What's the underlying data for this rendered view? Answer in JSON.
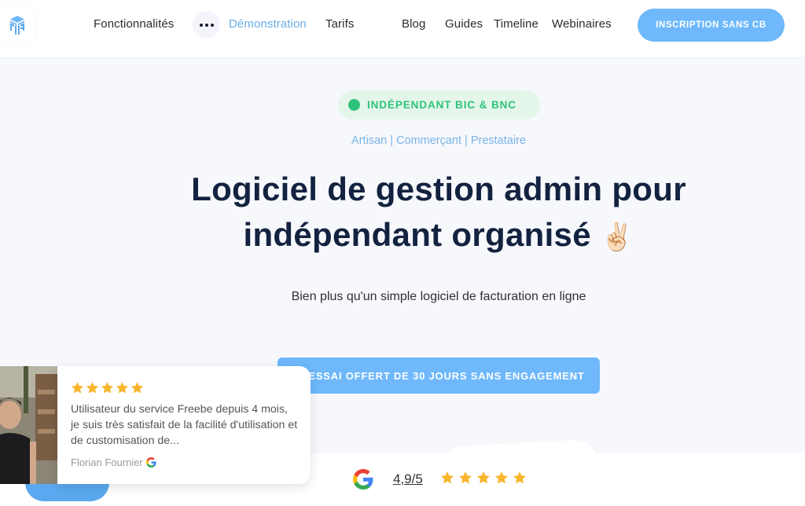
{
  "header": {
    "logo_icon": "freebe-logo-icon",
    "nav": [
      {
        "label": "Fonctionnalités",
        "active": false
      },
      {
        "label": "Démonstration",
        "active": true
      },
      {
        "label": "Tarifs",
        "active": false
      },
      {
        "label": "Blog",
        "active": false
      },
      {
        "label": "Guides",
        "active": false
      },
      {
        "label": "Timeline",
        "active": false
      },
      {
        "label": "Webinaires",
        "active": false
      }
    ],
    "more_icon": "more-horizontal-icon",
    "cta_label": "INSCRIPTION SANS CB"
  },
  "hero": {
    "badge": "INDÉPENDANT BIC & BNC",
    "subtags": "Artisan | Commerçant | Prestataire",
    "title_line1": "Logiciel de gestion admin pour",
    "title_line2": "indépendant organisé",
    "title_emoji": "✌🏻",
    "subtitle": "Bien plus qu'un simple logiciel de facturation en ligne",
    "cta_label": "ESSAI OFFERT DE 30 JOURS SANS ENGAGEMENT"
  },
  "review": {
    "stars": 5,
    "text": "Utilisateur du service Freebe depuis 4 mois, je suis très satisfait de la facilité d'utilisation et de customisation de...",
    "author": "Florian Fournier",
    "source_icon": "google-icon"
  },
  "rating": {
    "source_icon": "google-icon",
    "score": "4,9/5",
    "stars": 5
  },
  "colors": {
    "accent_blue": "#6eb8fb",
    "active_nav": "#6aaee8",
    "badge_green": "#2fc27a",
    "title_navy": "#13223f",
    "star_gold": "#f9b52c"
  }
}
